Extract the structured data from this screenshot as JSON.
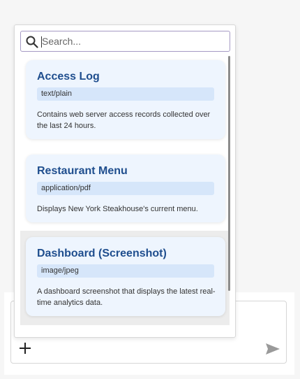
{
  "search": {
    "placeholder": "Search...",
    "value": ""
  },
  "resources": [
    {
      "title": "Access Log",
      "mime": "text/plain",
      "description": "Contains web server access records collected over the last 24 hours."
    },
    {
      "title": "Restaurant Menu",
      "mime": "application/pdf",
      "description": "Displays New York Steakhouse's current menu."
    },
    {
      "title": "Dashboard (Screenshot)",
      "mime": "image/jpeg",
      "description": "A dashboard screenshot that displays the latest real-time analytics data."
    }
  ],
  "composer": {
    "add_icon": "plus-icon",
    "send_icon": "send-icon"
  },
  "icons": {
    "search": "search-icon"
  },
  "colors": {
    "card_background": "#eef5fe",
    "mime_badge": "#d6e6fa",
    "title_text": "#1f4e8e",
    "search_border": "#a59ac4",
    "selected_row": "#ececec"
  }
}
